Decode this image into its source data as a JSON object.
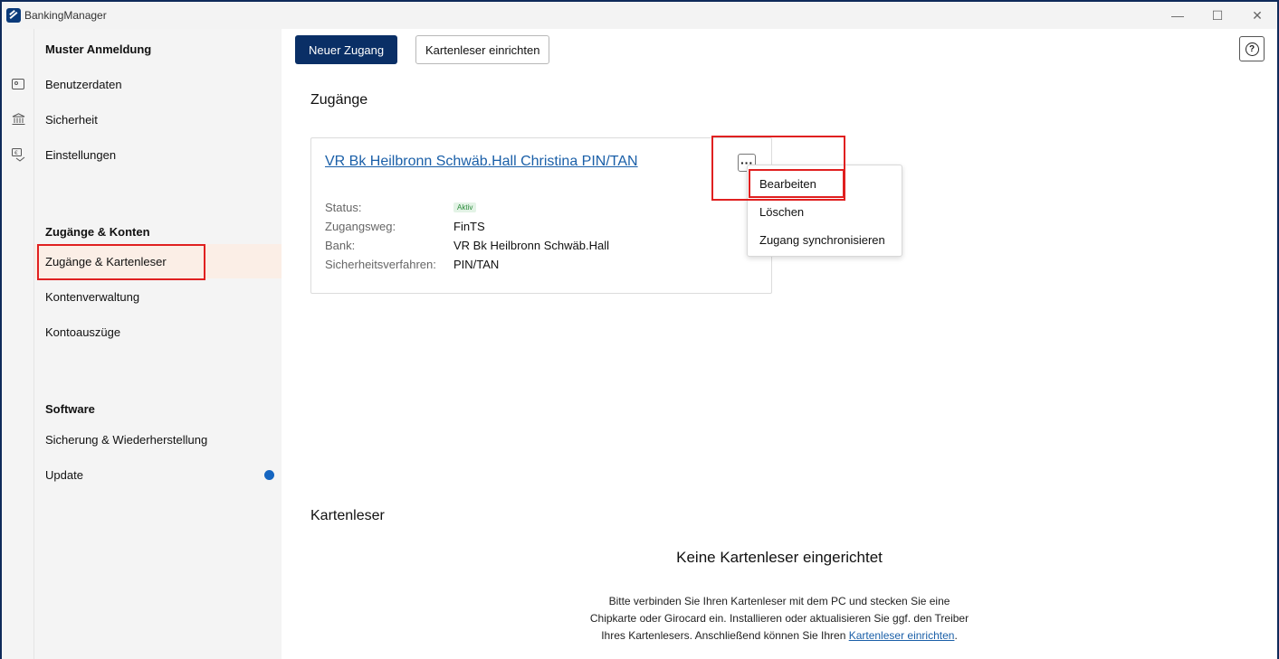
{
  "window": {
    "title": "BankingManager",
    "controls": {
      "minimize": "—",
      "maximize": "☐",
      "close": "✕"
    }
  },
  "rail": {
    "icons": [
      "id-card-icon",
      "bank-icon",
      "settings-hand-icon"
    ]
  },
  "sidebar": {
    "section1_heading": "Muster Anmeldung",
    "items1": [
      "Benutzerdaten",
      "Sicherheit",
      "Einstellungen"
    ],
    "section2_heading": "Zugänge & Konten",
    "items2": [
      "Zugänge & Kartenleser",
      "Kontenverwaltung",
      "Kontoauszüge"
    ],
    "section3_heading": "Software",
    "items3": [
      "Sicherung & Wiederherstellung",
      "Update"
    ]
  },
  "toolbar": {
    "new_access": "Neuer Zugang",
    "setup_reader": "Kartenleser einrichten",
    "help": "?"
  },
  "access_section": {
    "title": "Zugänge",
    "card": {
      "name": "VR Bk Heilbronn Schwäb.Hall Christina PIN/TAN",
      "more": "···",
      "status_label": "Status:",
      "status_value": "Aktiv",
      "path_label": "Zugangsweg:",
      "path_value": "FinTS",
      "bank_label": "Bank:",
      "bank_value": "VR Bk Heilbronn Schwäb.Hall",
      "security_label": "Sicherheitsverfahren:",
      "security_value": "PIN/TAN"
    },
    "menu": [
      "Bearbeiten",
      "Löschen",
      "Zugang synchronisieren"
    ]
  },
  "reader_section": {
    "title": "Kartenleser",
    "empty_title": "Keine Kartenleser eingerichtet",
    "empty_line1": "Bitte verbinden Sie Ihren Kartenleser mit dem PC und stecken Sie eine",
    "empty_line2": "Chipkarte oder Girocard ein. Installieren oder aktualisieren Sie ggf. den Treiber",
    "empty_line3_prefix": "Ihres Kartenlesers. Anschließend können Sie Ihren ",
    "empty_link": "Kartenleser einrichten",
    "empty_line3_suffix": "."
  },
  "colors": {
    "primary": "#0a2f66",
    "link": "#1a5fa8",
    "highlight": "#e02020",
    "active_bg": "#fbeee6",
    "update_dot": "#1565c0"
  }
}
